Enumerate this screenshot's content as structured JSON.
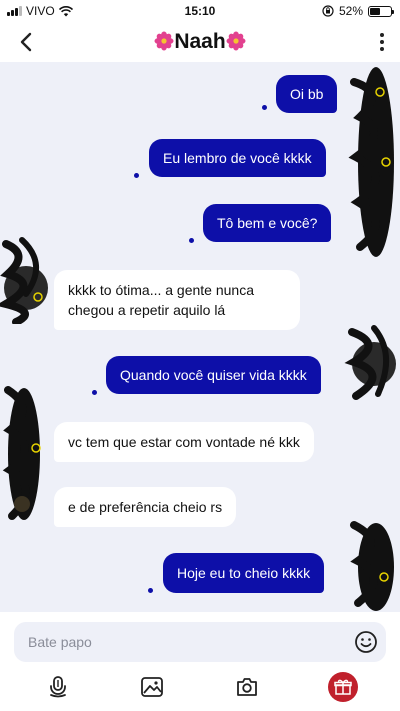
{
  "status": {
    "carrier": "VIVO",
    "time": "15:10",
    "battery_percent": "52%",
    "battery_level": 0.52
  },
  "header": {
    "title": "Naah",
    "flower_icon": "flower-emoji-icon",
    "back_icon": "chevron-left-icon",
    "more_icon": "vertical-dots-icon"
  },
  "messages": [
    {
      "direction": "out",
      "text": "Oi bb"
    },
    {
      "direction": "out",
      "text": "Eu lembro de você kkkk"
    },
    {
      "direction": "out",
      "text": "Tô bem e você?"
    },
    {
      "direction": "in",
      "text": "kkkk to ótima... a gente nunca chegou a repetir aquilo lá"
    },
    {
      "direction": "out",
      "text": "Quando você quiser vida kkkk"
    },
    {
      "direction": "in",
      "text": "vc tem que estar com vontade né kkk"
    },
    {
      "direction": "in",
      "text": "e de preferência cheio rs"
    },
    {
      "direction": "out",
      "text": "Hoje eu to cheio kkkk"
    }
  ],
  "composer": {
    "placeholder": "Bate papo",
    "emoji_icon": "smiley-icon"
  },
  "toolbar": {
    "icons": [
      "microphone-icon",
      "image-icon",
      "camera-icon",
      "gift-icon"
    ]
  },
  "colors": {
    "outgoing_bubble": "#0d0fa8",
    "incoming_bubble": "#ffffff",
    "chat_background": "#eef0f8",
    "gift_button": "#c0202c"
  }
}
